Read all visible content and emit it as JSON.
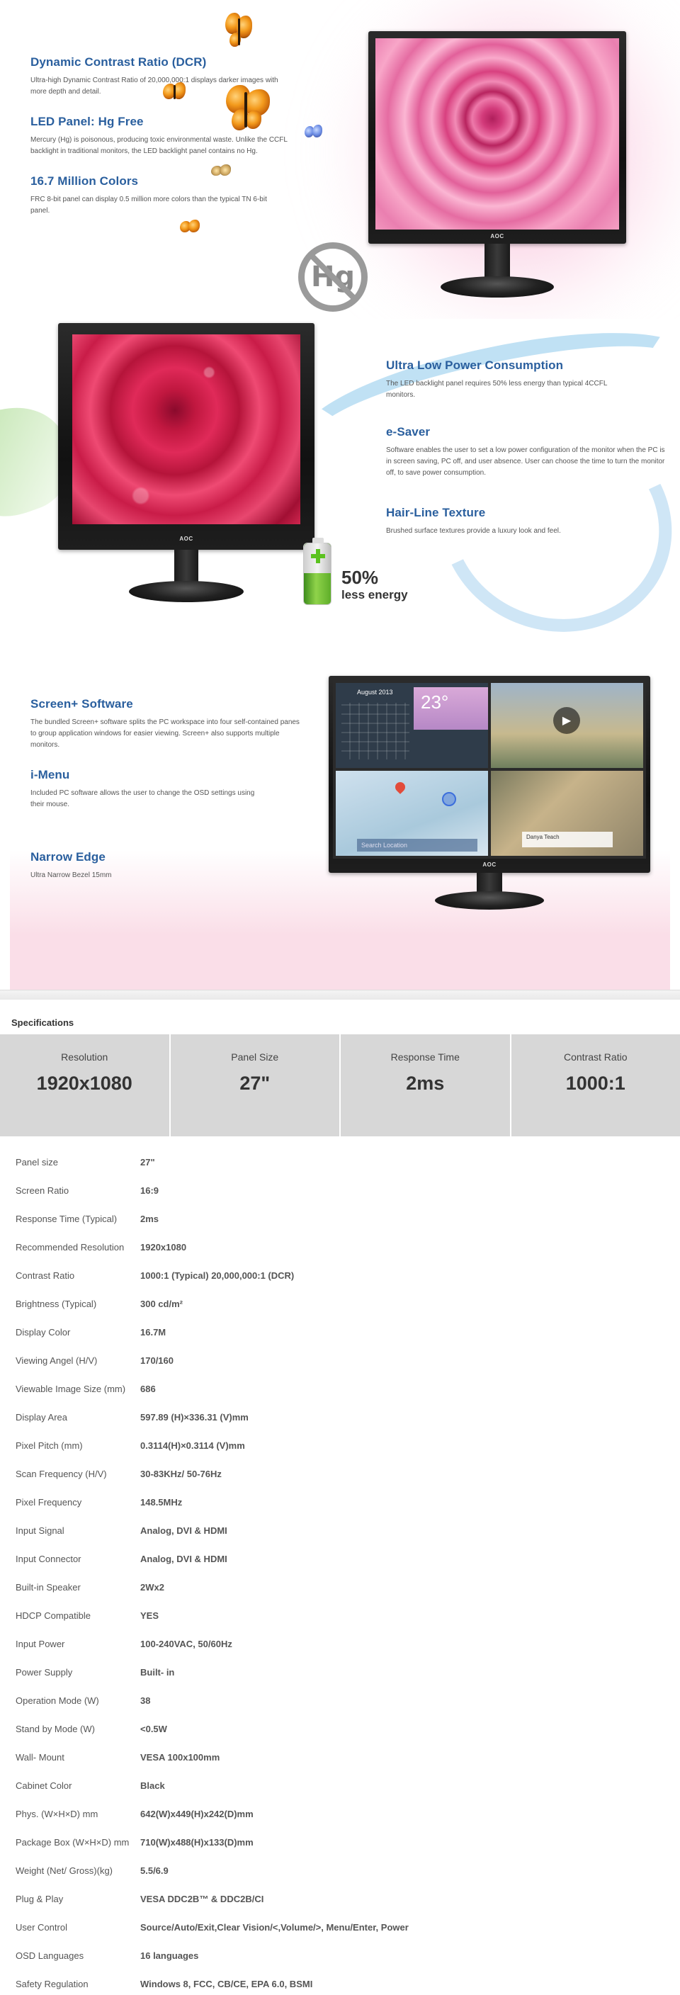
{
  "features_top": [
    {
      "title": "Dynamic Contrast Ratio (DCR)",
      "desc": "Ultra-high Dynamic Contrast Ratio of 20,000,000:1 displays darker images with more depth and detail."
    },
    {
      "title": "LED Panel: Hg Free",
      "desc": "Mercury (Hg) is poisonous, producing toxic environmental waste. Unlike the CCFL backlight in traditional monitors, the LED backlight panel contains no Hg."
    },
    {
      "title": "16.7 Million Colors",
      "desc": "FRC 8-bit panel can display 0.5 million more colors than the typical TN 6-bit panel."
    }
  ],
  "hg_badge": "Hg",
  "brand_logo": "AOC",
  "features_mid": [
    {
      "title": "Ultra Low Power Consumption",
      "desc": "The LED backlight panel requires 50% less energy than typical 4CCFL monitors."
    },
    {
      "title": "e-Saver",
      "desc": "Software enables the user to set a low power configuration of the monitor when the PC is in screen saving, PC off, and user absence. User can choose the time to turn the monitor off, to save power consumption."
    },
    {
      "title": "Hair-Line Texture",
      "desc": "Brushed surface textures provide a luxury look and feel."
    }
  ],
  "energy": {
    "percent": "50%",
    "label": "less energy"
  },
  "features_bottom": [
    {
      "title": "Screen+ Software",
      "desc": "The bundled Screen+ software splits the PC workspace into four self-contained panes to group application windows for easier viewing. Screen+ also supports multiple monitors."
    },
    {
      "title": "i-Menu",
      "desc": "Included PC software allows the user to change the OSD settings using their mouse."
    },
    {
      "title": "Narrow Edge",
      "desc": "Ultra Narrow Bezel 15mm"
    }
  ],
  "screen_ui": {
    "calendar_title": "August 2013",
    "temperature": "23°",
    "search_placeholder": "Search Location",
    "contact_name": "Danya Teach"
  },
  "specs_title": "Specifications",
  "summary": [
    {
      "label": "Resolution",
      "value": "1920x1080"
    },
    {
      "label": "Panel Size",
      "value": "27\""
    },
    {
      "label": "Response Time",
      "value": "2ms"
    },
    {
      "label": "Contrast Ratio",
      "value": "1000:1"
    }
  ],
  "specs": [
    {
      "k": "Panel size",
      "v": "27\""
    },
    {
      "k": "Screen Ratio",
      "v": "16:9"
    },
    {
      "k": "Response Time (Typical)",
      "v": "2ms"
    },
    {
      "k": "Recommended Resolution",
      "v": "1920x1080"
    },
    {
      "k": "Contrast Ratio",
      "v": "1000:1 (Typical) 20,000,000:1 (DCR)"
    },
    {
      "k": "Brightness (Typical)",
      "v": "300 cd/m²"
    },
    {
      "k": "Display Color",
      "v": "16.7M"
    },
    {
      "k": "Viewing Angel (H/V)",
      "v": "170/160"
    },
    {
      "k": "Viewable Image Size (mm)",
      "v": "686"
    },
    {
      "k": "Display Area",
      "v": "597.89 (H)×336.31 (V)mm"
    },
    {
      "k": "Pixel Pitch (mm)",
      "v": "0.3114(H)×0.3114 (V)mm"
    },
    {
      "k": "Scan Frequency (H/V)",
      "v": "30-83KHz/ 50-76Hz"
    },
    {
      "k": "Pixel Frequency",
      "v": "148.5MHz"
    },
    {
      "k": "Input Signal",
      "v": "Analog, DVI & HDMI"
    },
    {
      "k": "Input Connector",
      "v": "Analog, DVI & HDMI"
    },
    {
      "k": "Built-in Speaker",
      "v": "2Wx2"
    },
    {
      "k": "HDCP Compatible",
      "v": "YES"
    },
    {
      "k": "Input Power",
      "v": "100-240VAC, 50/60Hz"
    },
    {
      "k": "Power Supply",
      "v": "Built- in"
    },
    {
      "k": "Operation Mode (W)",
      "v": "38"
    },
    {
      "k": "Stand by Mode (W)",
      "v": "<0.5W"
    },
    {
      "k": "Wall- Mount",
      "v": "VESA 100x100mm"
    },
    {
      "k": "Cabinet Color",
      "v": "Black"
    },
    {
      "k": "Phys. (W×H×D) mm",
      "v": "642(W)x449(H)x242(D)mm"
    },
    {
      "k": "Package Box (W×H×D) mm",
      "v": "710(W)x488(H)x133(D)mm"
    },
    {
      "k": "Weight (Net/ Gross)(kg)",
      "v": "5.5/6.9"
    },
    {
      "k": "Plug & Play",
      "v": "VESA DDC2B™ & DDC2B/CI"
    },
    {
      "k": "User Control",
      "v": "Source/Auto/Exit,Clear Vision/<,Volume/>, Menu/Enter, Power"
    },
    {
      "k": "OSD Languages",
      "v": "16 languages"
    },
    {
      "k": "Safety Regulation",
      "v": "Windows 8, FCC, CB/CE, EPA 6.0, BSMI"
    }
  ]
}
